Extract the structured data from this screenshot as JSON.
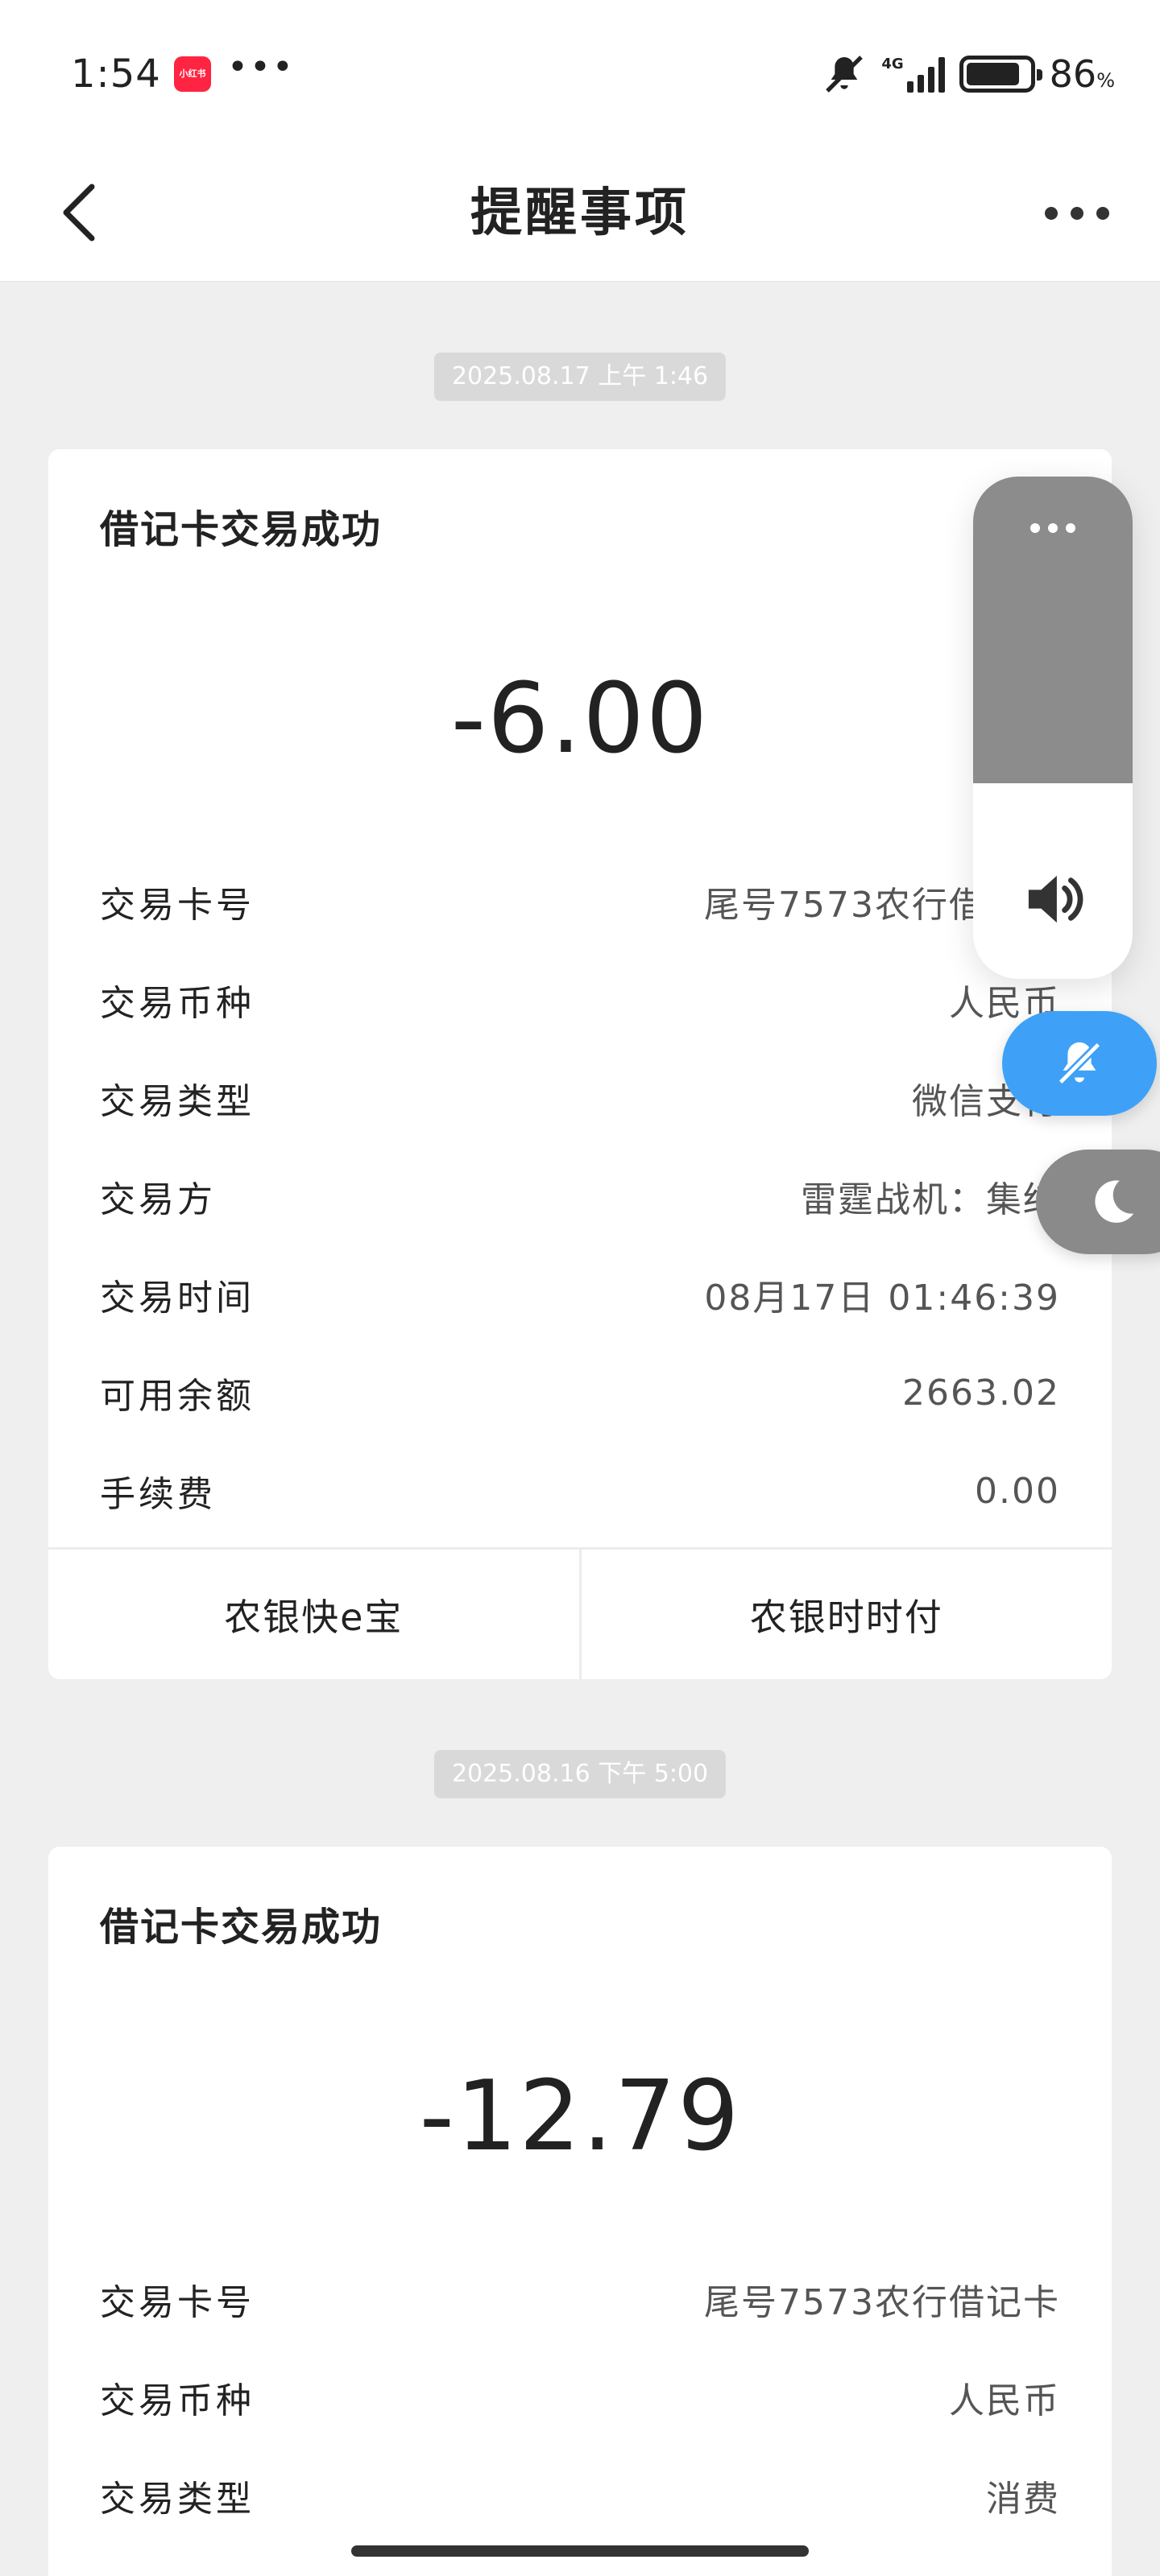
{
  "status_bar": {
    "time": "1:54",
    "app_badge": "小红书",
    "overflow": "•••",
    "network": "4G",
    "battery": "86",
    "battery_unit": "%",
    "battery_level": 0.86
  },
  "header": {
    "title": "提醒事项"
  },
  "messages": [
    {
      "timestamp": "2025.08.17 上午 1:46",
      "title": "借记卡交易成功",
      "amount": "-6.00",
      "rows": [
        {
          "label": "交易卡号",
          "value": "尾号7573农行借记卡"
        },
        {
          "label": "交易币种",
          "value": "人民币"
        },
        {
          "label": "交易类型",
          "value": "微信支付"
        },
        {
          "label": "交易方",
          "value": "雷霆战机：集结"
        },
        {
          "label": "交易时间",
          "value": "08月17日 01:46:39"
        },
        {
          "label": "可用余额",
          "value": "2663.02"
        },
        {
          "label": "手续费",
          "value": "0.00"
        }
      ],
      "actions": [
        "农银快e宝",
        "农银时时付"
      ]
    },
    {
      "timestamp": "2025.08.16 下午 5:00",
      "title": "借记卡交易成功",
      "amount": "-12.79",
      "rows": [
        {
          "label": "交易卡号",
          "value": "尾号7573农行借记卡"
        },
        {
          "label": "交易币种",
          "value": "人民币"
        },
        {
          "label": "交易类型",
          "value": "消费"
        }
      ]
    }
  ],
  "overlay": {
    "volume_level": 0.39,
    "volume_menu": "•••"
  },
  "colors": {
    "accent_blue": "#3ea1f7",
    "page_bg": "#efefef",
    "chip_bg": "#d9d9d9"
  }
}
